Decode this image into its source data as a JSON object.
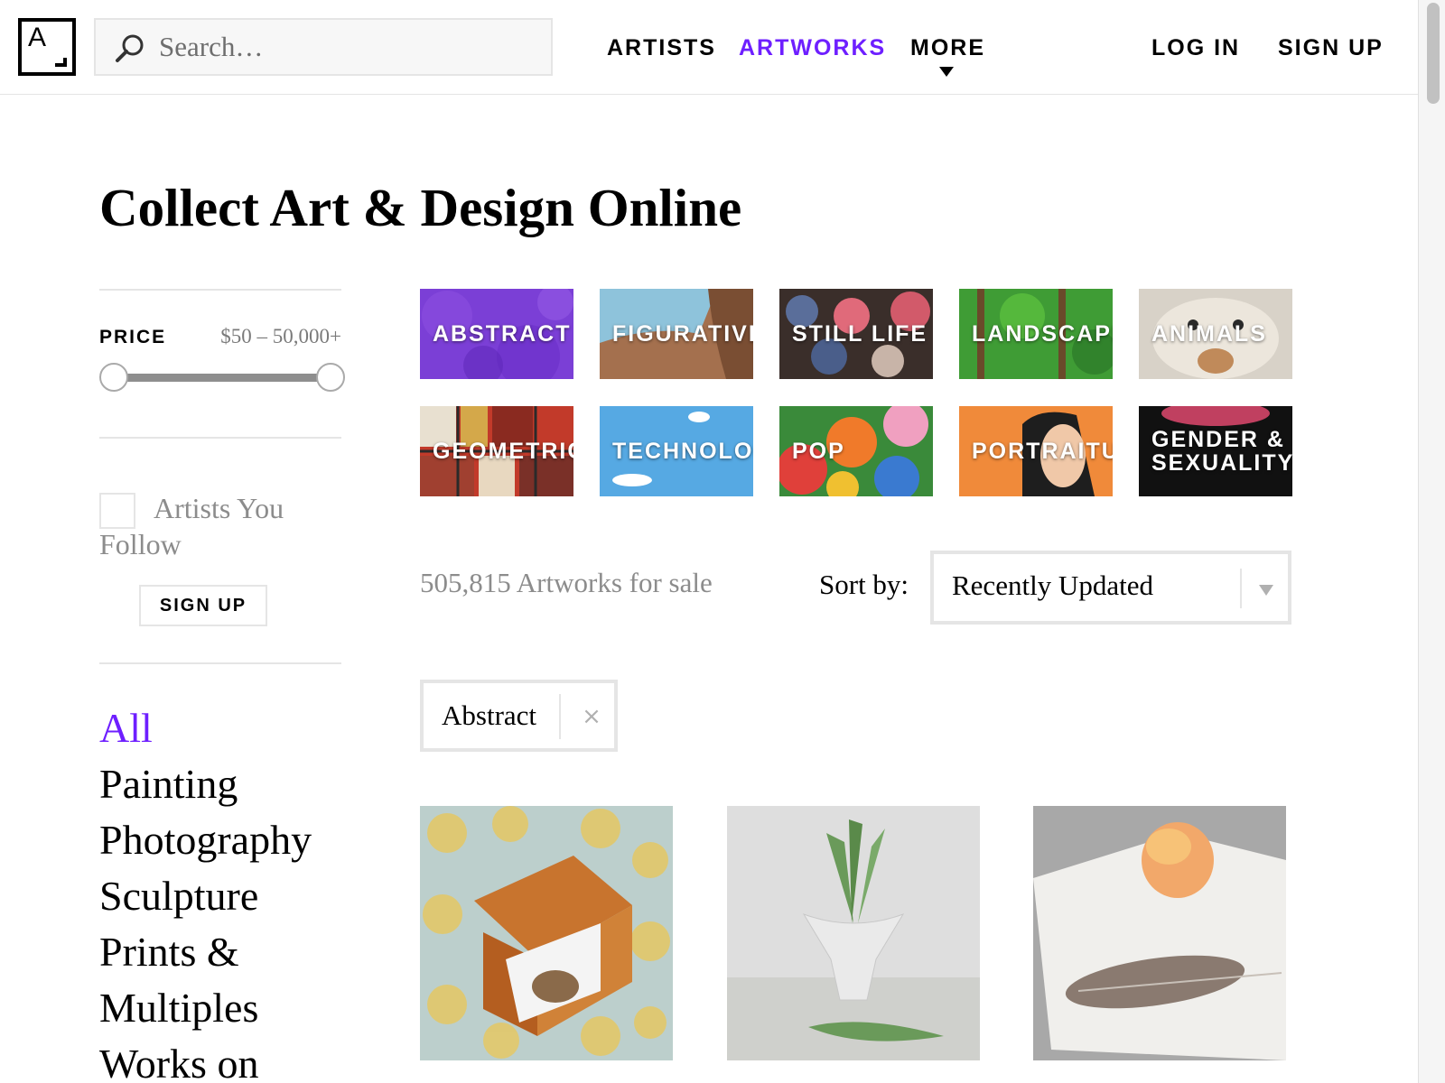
{
  "header": {
    "logo_text": "A",
    "search_placeholder": "Search…",
    "nav": {
      "artists": "ARTISTS",
      "artworks": "ARTWORKS",
      "more": "MORE",
      "login": "LOG IN",
      "signup": "SIGN UP"
    },
    "active_color": "#6E1FFF"
  },
  "page": {
    "title": "Collect Art & Design Online"
  },
  "sidebar": {
    "price_label": "PRICE",
    "price_range": "$50 – 50,000+",
    "follow_label": "Artists You Follow",
    "signup_button": "SIGN UP",
    "categories": [
      "All",
      "Painting",
      "Photography",
      "Sculpture",
      "Prints &",
      "Multiples",
      "Works on"
    ]
  },
  "genres": [
    "ABSTRACT",
    "FIGURATIVE",
    "STILL LIFE",
    "LANDSCAPE",
    "ANIMALS",
    "GEOMETRIC",
    "TECHNOLOGY",
    "POP",
    "PORTRAITURE",
    "GENDER & SEXUALITY"
  ],
  "results": {
    "count_text": "505,815 Artworks for sale",
    "sort_label": "Sort by:",
    "sort_value": "Recently Updated"
  },
  "active_filter": {
    "label": "Abstract",
    "close": "×"
  },
  "artworks": [
    {
      "subject": "box with bird on floral background"
    },
    {
      "subject": "lily of the valley in glass vase"
    },
    {
      "subject": "mango and feather on white cloth"
    }
  ]
}
